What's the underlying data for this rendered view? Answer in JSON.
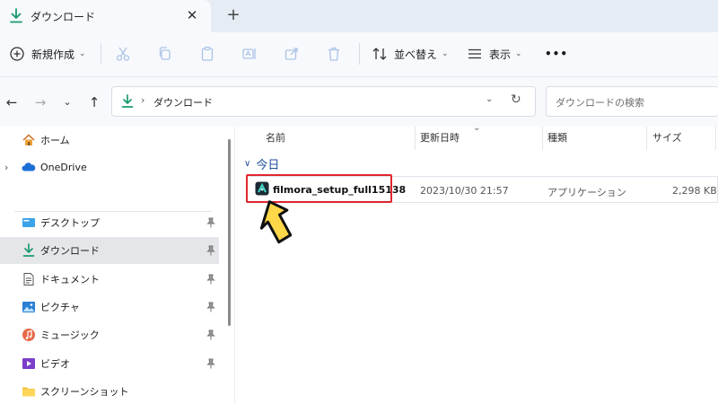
{
  "tab": {
    "title": "ダウンロード",
    "close_label": "✕",
    "new_tab_label": "+"
  },
  "toolbar": {
    "new_label": "新規作成",
    "sort_label": "並べ替え",
    "view_label": "表示",
    "more_label": "•••"
  },
  "address": {
    "path": "ダウンロード",
    "search_placeholder": "ダウンロードの検索"
  },
  "sidebar": {
    "items": [
      {
        "label": "ホーム",
        "icon": "home-icon"
      },
      {
        "label": "OneDrive",
        "icon": "cloud-icon"
      },
      {
        "label": "デスクトップ",
        "icon": "desktop-icon",
        "pinned": true
      },
      {
        "label": "ダウンロード",
        "icon": "download-icon",
        "pinned": true,
        "active": true
      },
      {
        "label": "ドキュメント",
        "icon": "document-icon",
        "pinned": true
      },
      {
        "label": "ピクチャ",
        "icon": "pictures-icon",
        "pinned": true
      },
      {
        "label": "ミュージック",
        "icon": "music-icon",
        "pinned": true
      },
      {
        "label": "ビデオ",
        "icon": "video-icon",
        "pinned": true
      },
      {
        "label": "スクリーンショット",
        "icon": "folder-icon"
      }
    ]
  },
  "columns": {
    "name": "名前",
    "modified": "更新日時",
    "type": "種類",
    "size": "サイズ"
  },
  "group": {
    "label": "今日"
  },
  "files": [
    {
      "name": "filmora_setup_full15138",
      "modified": "2023/10/30 21:57",
      "type": "アプリケーション",
      "size": "2,298 KB"
    }
  ],
  "colors": {
    "highlight_box": "#e0262f",
    "pointer_arrow": "#ffd84a",
    "group_heading": "#1f4e9c",
    "accent_green": "#1a9a6e"
  }
}
